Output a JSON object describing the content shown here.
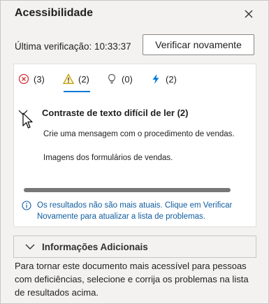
{
  "pane": {
    "title": "Acessibilidade",
    "close_icon": "close-icon"
  },
  "status": {
    "last_check": "Última verificação: 10:33:37",
    "verify_button": "Verificar novamente"
  },
  "tabs": [
    {
      "icon": "error-circle-icon",
      "count": "(3)",
      "color": "#d13438"
    },
    {
      "icon": "warning-triangle-icon",
      "count": "(2)",
      "color": "#c19c00",
      "selected": true
    },
    {
      "icon": "lightbulb-icon",
      "count": "(0)",
      "color": "#605e5c"
    },
    {
      "icon": "lightning-icon",
      "count": "(2)",
      "color": "#0078d4"
    }
  ],
  "group": {
    "title": "Contraste de texto difícil de ler (2)",
    "items": [
      "Crie uma mensagem com o procedimento de vendas.",
      "Imagens dos formulários de vendas."
    ]
  },
  "notice": "Os resultados não são mais atuais. Clique em Verificar Novamente para atualizar a lista de problemas.",
  "additional": {
    "label": "Informações Adicionais"
  },
  "description": "Para tornar este documento mais acessível para pessoas com deficiências, selecione e corrija os problemas na lista de resultados acima.",
  "colors": {
    "accent": "#0078d4",
    "notice_text": "#0f5c9e",
    "panel_bg": "#f3f2f1"
  }
}
